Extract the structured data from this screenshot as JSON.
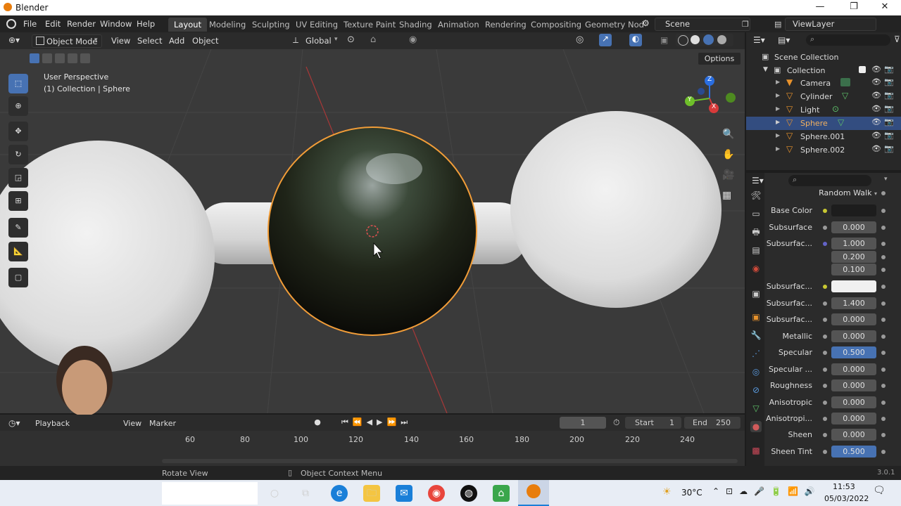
{
  "window": {
    "app_title": "Blender",
    "minimize": "—",
    "maximize": "❐",
    "close": "✕"
  },
  "menu": [
    "File",
    "Edit",
    "Render",
    "Window",
    "Help"
  ],
  "workspaces": [
    "Layout",
    "Modeling",
    "Sculpting",
    "UV Editing",
    "Texture Paint",
    "Shading",
    "Animation",
    "Rendering",
    "Compositing",
    "Geometry Nod"
  ],
  "scene": {
    "label": "Scene"
  },
  "viewlayer": {
    "label": "ViewLayer"
  },
  "viewport_header": {
    "mode": "Object Mode",
    "view": "View",
    "select": "Select",
    "add": "Add",
    "object": "Object",
    "transform": "Global",
    "options": "Options"
  },
  "viewport": {
    "perspective": "User Perspective",
    "collection_info": "(1) Collection | Sphere",
    "gizmo_x": "X",
    "gizmo_y": "Y",
    "gizmo_z": "Z"
  },
  "timeline": {
    "playback": "Playback",
    "view": "View",
    "marker": "Marker",
    "current_frame": "1",
    "start_label": "Start",
    "start_value": "1",
    "end_label": "End",
    "end_value": "250",
    "ticks": [
      "60",
      "80",
      "100",
      "120",
      "140",
      "160",
      "180",
      "200",
      "220",
      "240"
    ]
  },
  "statusbar": {
    "left": "Rotate View",
    "middle": "Object Context Menu",
    "version": "3.0.1"
  },
  "outliner": {
    "scene_collection": "Scene Collection",
    "collection": "Collection",
    "items": [
      "Camera",
      "Cylinder",
      "Light",
      "Sphere",
      "Sphere.001",
      "Sphere.002"
    ],
    "selected": "Sphere"
  },
  "properties": {
    "subsurface_method": "Random Walk",
    "rows": [
      {
        "label": "Base Color",
        "value": "",
        "style": "dark",
        "dot": "yellow"
      },
      {
        "label": "Subsurface",
        "value": "0.000",
        "style": "",
        "dot": ""
      },
      {
        "label": "Subsurfac...",
        "value": "1.000",
        "style": "",
        "dot": "purple"
      },
      {
        "label": "",
        "value": "0.200",
        "style": "",
        "dot": "none"
      },
      {
        "label": "",
        "value": "0.100",
        "style": "",
        "dot": "none"
      },
      {
        "label": "Subsurfac...",
        "value": "",
        "style": "white",
        "dot": "yellow"
      },
      {
        "label": "Subsurfac...",
        "value": "1.400",
        "style": "",
        "dot": ""
      },
      {
        "label": "Subsurfac...",
        "value": "0.000",
        "style": "",
        "dot": ""
      },
      {
        "label": "Metallic",
        "value": "0.000",
        "style": "",
        "dot": ""
      },
      {
        "label": "Specular",
        "value": "0.500",
        "style": "blue",
        "dot": ""
      },
      {
        "label": "Specular ...",
        "value": "0.000",
        "style": "",
        "dot": ""
      },
      {
        "label": "Roughness",
        "value": "0.000",
        "style": "",
        "dot": ""
      },
      {
        "label": "Anisotropic",
        "value": "0.000",
        "style": "",
        "dot": ""
      },
      {
        "label": "Anisotropi...",
        "value": "0.000",
        "style": "",
        "dot": ""
      },
      {
        "label": "Sheen",
        "value": "0.000",
        "style": "",
        "dot": ""
      },
      {
        "label": "Sheen Tint",
        "value": "0.500",
        "style": "blue",
        "dot": ""
      }
    ]
  },
  "taskbar": {
    "temperature": "30°C",
    "time": "11:53",
    "date": "05/03/2022"
  },
  "colors": {
    "accent": "#4772b3",
    "selection_outline": "#f29d38",
    "outliner_selected": "#334d80"
  }
}
